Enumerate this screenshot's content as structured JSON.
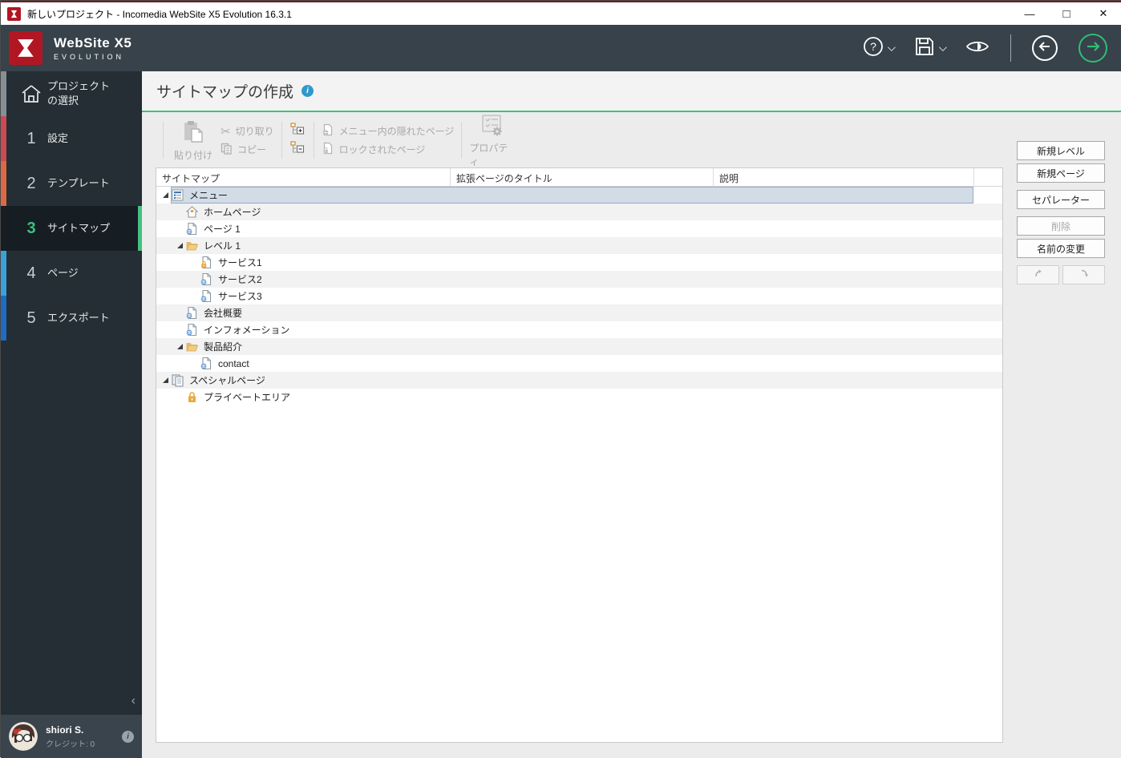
{
  "window": {
    "title": "新しいプロジェクト - Incomedia WebSite X5 Evolution 16.3.1",
    "minimize_glyph": "—",
    "maximize_glyph": "□",
    "close_glyph": "✕"
  },
  "header": {
    "brand": "WebSite X5",
    "brand_sub": "EVOLUTION"
  },
  "sidebar": {
    "items": [
      {
        "num": "",
        "label1": "プロジェクト",
        "label2": "の選択"
      },
      {
        "num": "1",
        "label": "設定"
      },
      {
        "num": "2",
        "label": "テンプレート"
      },
      {
        "num": "3",
        "label": "サイトマップ"
      },
      {
        "num": "4",
        "label": "ページ"
      },
      {
        "num": "5",
        "label": "エクスポート"
      }
    ],
    "collapse_glyph": "‹",
    "user": {
      "name": "shiori S.",
      "credits": "クレジット: 0",
      "info_glyph": "i"
    }
  },
  "page": {
    "title": "サイトマップの作成",
    "info_glyph": "i"
  },
  "toolbar": {
    "paste": "貼り付け",
    "cut": "切り取り",
    "copy": "コピー",
    "scissors_glyph": "✂",
    "hidden_pages": "メニュー内の隠れたページ",
    "locked_pages": "ロックされたページ",
    "properties": "プロパティ"
  },
  "table": {
    "columns": [
      "サイトマップ",
      "拡張ページのタイトル",
      "説明",
      ""
    ]
  },
  "tree": {
    "rows": [
      {
        "label": "メニュー",
        "icon": "menu-icon",
        "selected": true
      },
      {
        "label": "ホームページ",
        "icon": "home-icon"
      },
      {
        "label": "ページ 1",
        "icon": "page-globe-icon"
      },
      {
        "label": "レベル 1",
        "icon": "folder-open-icon"
      },
      {
        "label": "サービス1",
        "icon": "page-lock-icon"
      },
      {
        "label": "サービス2",
        "icon": "page-globe-icon"
      },
      {
        "label": "サービス3",
        "icon": "page-globe-icon"
      },
      {
        "label": "会社概要",
        "icon": "page-globe-icon"
      },
      {
        "label": "インフォメーション",
        "icon": "page-globe-icon"
      },
      {
        "label": "製品紹介",
        "icon": "folder-open-icon"
      },
      {
        "label": "contact",
        "icon": "page-globe-icon"
      },
      {
        "label": "スペシャルページ",
        "icon": "special-pages-icon"
      },
      {
        "label": "プライベートエリア",
        "icon": "lock-icon"
      }
    ]
  },
  "actions": {
    "new_level": "新規レベル",
    "new_page": "新規ページ",
    "separator": "セパレーター",
    "delete": "削除",
    "rename": "名前の変更"
  },
  "colors": {
    "accent_green": "#3fbf7e",
    "header_bg": "#37424a",
    "sidebar_bg": "#242e34",
    "selection_bg": "#d2dce7",
    "selection_border": "#93abc4",
    "step1_strip": "#cc4a54",
    "step2_strip": "#dd6844",
    "step4_strip": "#3ba2d9",
    "step5_strip": "#1f6cc0",
    "home_strip": "#878f96"
  }
}
